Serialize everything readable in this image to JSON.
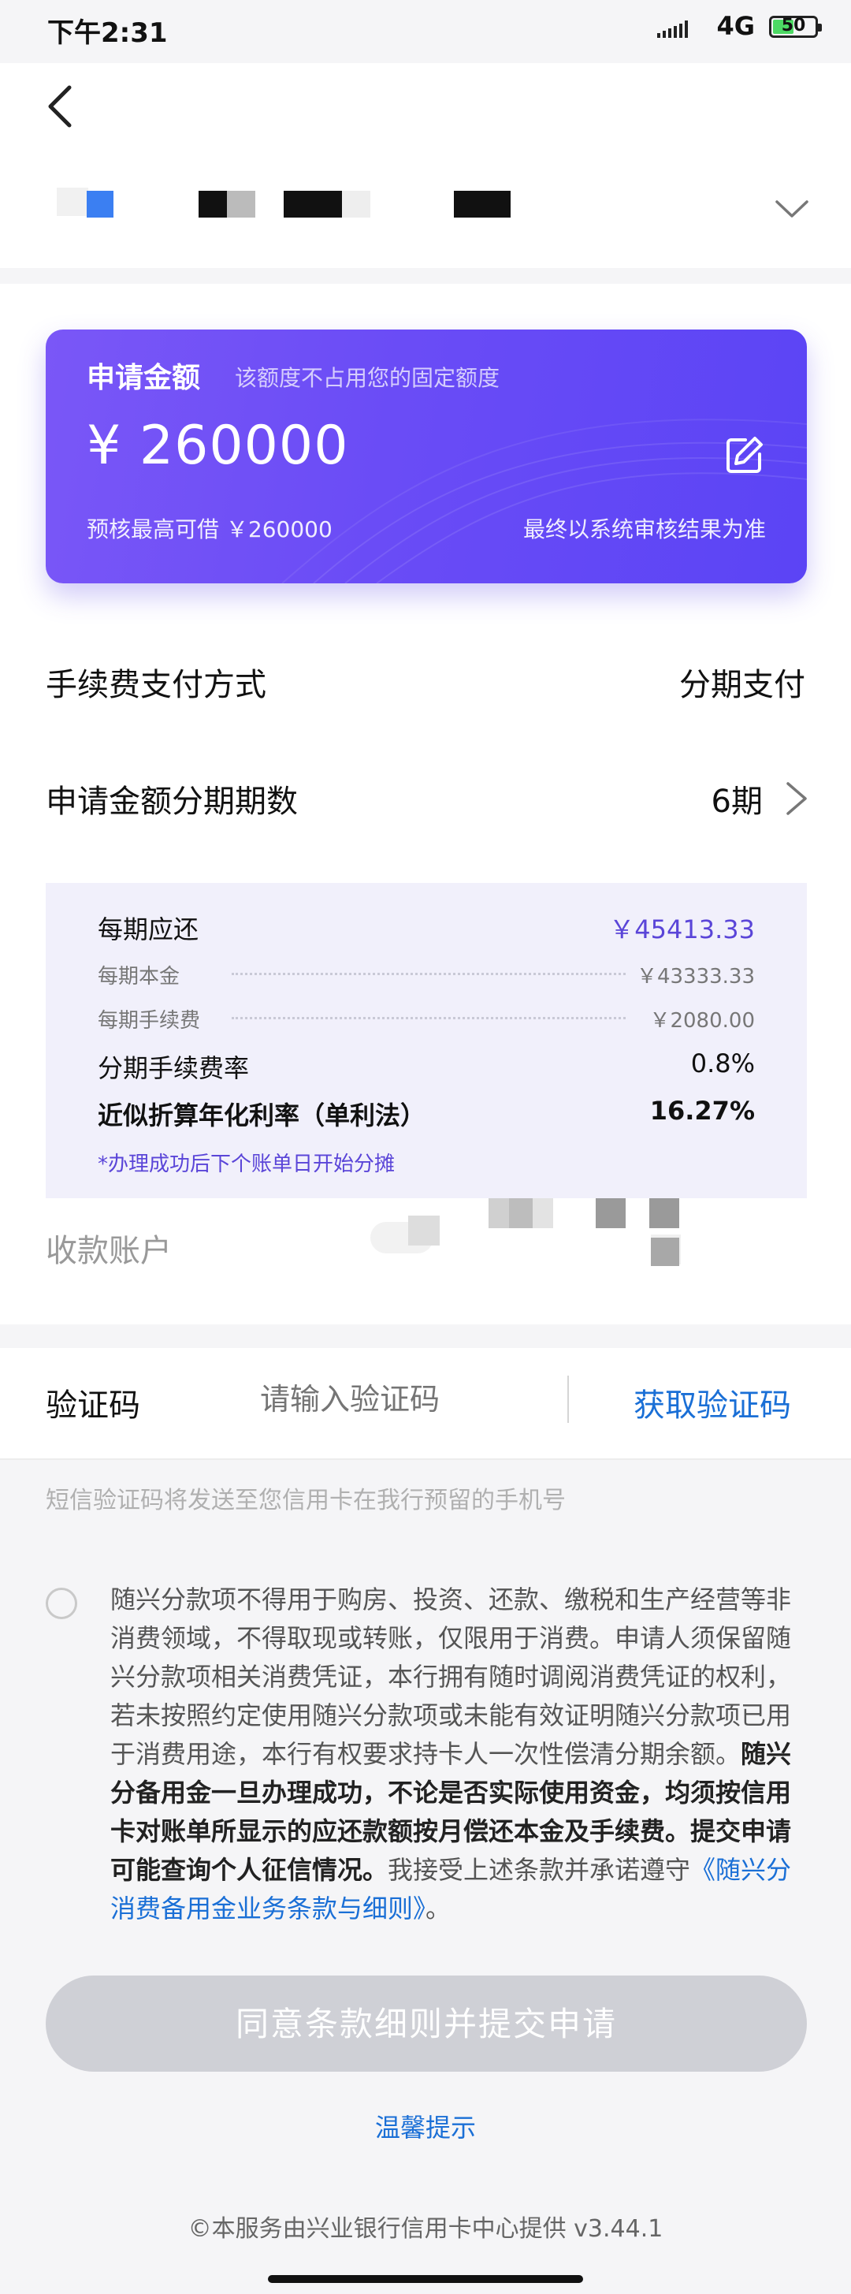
{
  "status_bar": {
    "time": "下午2:31",
    "network": "4G",
    "battery": "50"
  },
  "card": {
    "title": "申请金额",
    "subtitle": "该额度不占用您的固定额度",
    "amount": "¥ 260000",
    "pre_approved": "预核最高可借 ￥260000",
    "final_note": "最终以系统审核结果为准"
  },
  "fee_method": {
    "label": "手续费支付方式",
    "value": "分期支付"
  },
  "installments": {
    "label": "申请金额分期期数",
    "value": "6期"
  },
  "details": {
    "per_period": {
      "label": "每期应还",
      "value": "￥45413.33"
    },
    "principal": {
      "label": "每期本金",
      "value": "￥43333.33"
    },
    "fee": {
      "label": "每期手续费",
      "value": "￥2080.00"
    },
    "fee_rate": {
      "label": "分期手续费率",
      "value": "0.8%"
    },
    "apr": {
      "label": "近似折算年化利率（单利法）",
      "value": "16.27%"
    },
    "note": "*办理成功后下个账单日开始分摊"
  },
  "receiving_account": {
    "label": "收款账户"
  },
  "sms": {
    "label": "验证码",
    "placeholder": "请输入验证码",
    "get_code": "获取验证码",
    "hint": "短信验证码将发送至您信用卡在我行预留的手机号"
  },
  "agreement": {
    "text_part1": "随兴分款项不得用于购房、投资、还款、缴税和生产经营等非消费领域，不得取现或转账，仅限用于消费。申请人须保留随兴分款项相关消费凭证，本行拥有随时调阅消费凭证的权利，若未按照约定使用随兴分款项或未能有效证明随兴分款项已用于消费用途，本行有权要求持卡人一次性偿清分期余额。",
    "text_bold": "随兴分备用金一旦办理成功，不论是否实际使用资金，均须按信用卡对账单所显示的应还款额按月偿还本金及手续费。提交申请可能查询个人征信情况。",
    "text_part2": "我接受上述条款并承诺遵守",
    "link": "《随兴分消费备用金业务条款与细则》",
    "text_end": "。"
  },
  "submit_label": "同意条款细则并提交申请",
  "tips_label": "温馨提示",
  "footer": "©本服务由兴业银行信用卡中心提供 v3.44.1",
  "colors": {
    "card_accent": "#6a4cf6",
    "link": "#1a6fd6",
    "detail_purple": "#5a45d8"
  }
}
